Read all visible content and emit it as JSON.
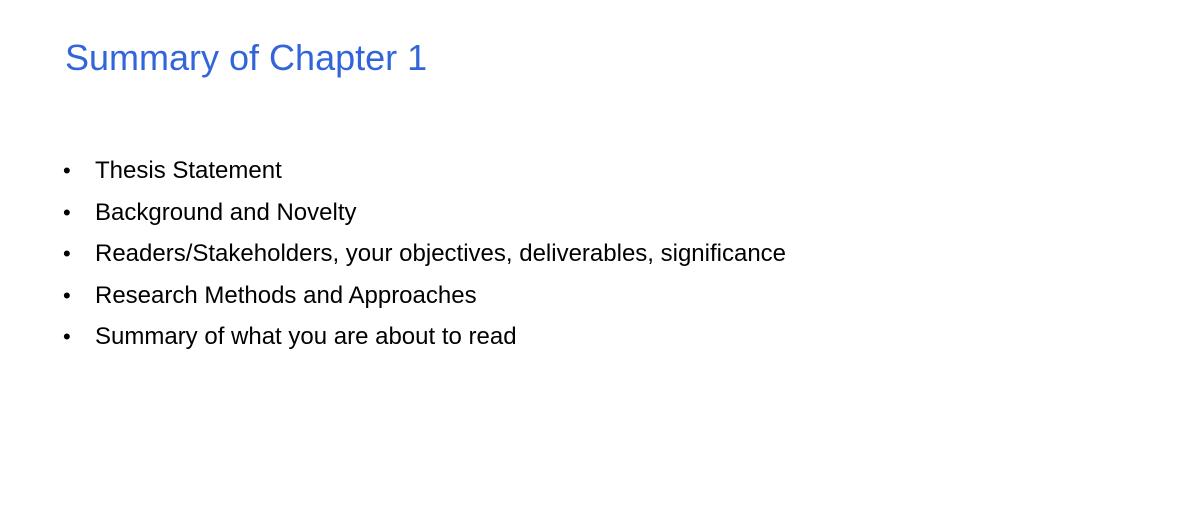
{
  "theme": {
    "title_color": "#3265d9",
    "text_color": "#000000",
    "background": "#ffffff"
  },
  "slide": {
    "title": "Summary of Chapter 1",
    "bullet_glyph": "•",
    "bullets": [
      {
        "text": "Thesis Statement"
      },
      {
        "text": "Background and Novelty"
      },
      {
        "text": "Readers/Stakeholders, your objectives, deliverables, significance"
      },
      {
        "text": "Research Methods and Approaches"
      },
      {
        "text": "Summary of what you are about to read"
      }
    ]
  }
}
